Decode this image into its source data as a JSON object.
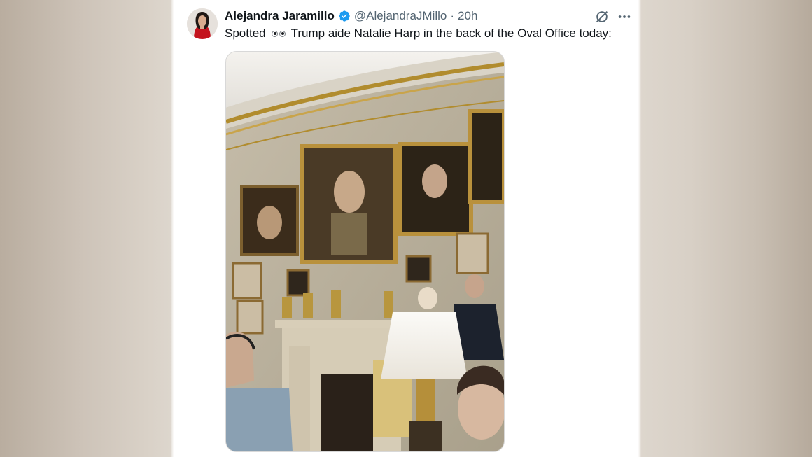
{
  "tweet": {
    "author_name": "Alejandra Jaramillo",
    "handle": "@AlejandraJMillo",
    "separator": "·",
    "time": "20h",
    "text_before": "Spotted",
    "text_after": "Trump aide Natalie Harp in the back of the Oval Office today:"
  },
  "icons": {
    "verified": "verified-badge-icon",
    "grok": "grok-icon",
    "more": "more-options-icon",
    "emoji": "eyes-emoji-icon"
  },
  "colors": {
    "verified_blue": "#1d9bf0",
    "text_primary": "#0f1419",
    "text_secondary": "#536471"
  }
}
